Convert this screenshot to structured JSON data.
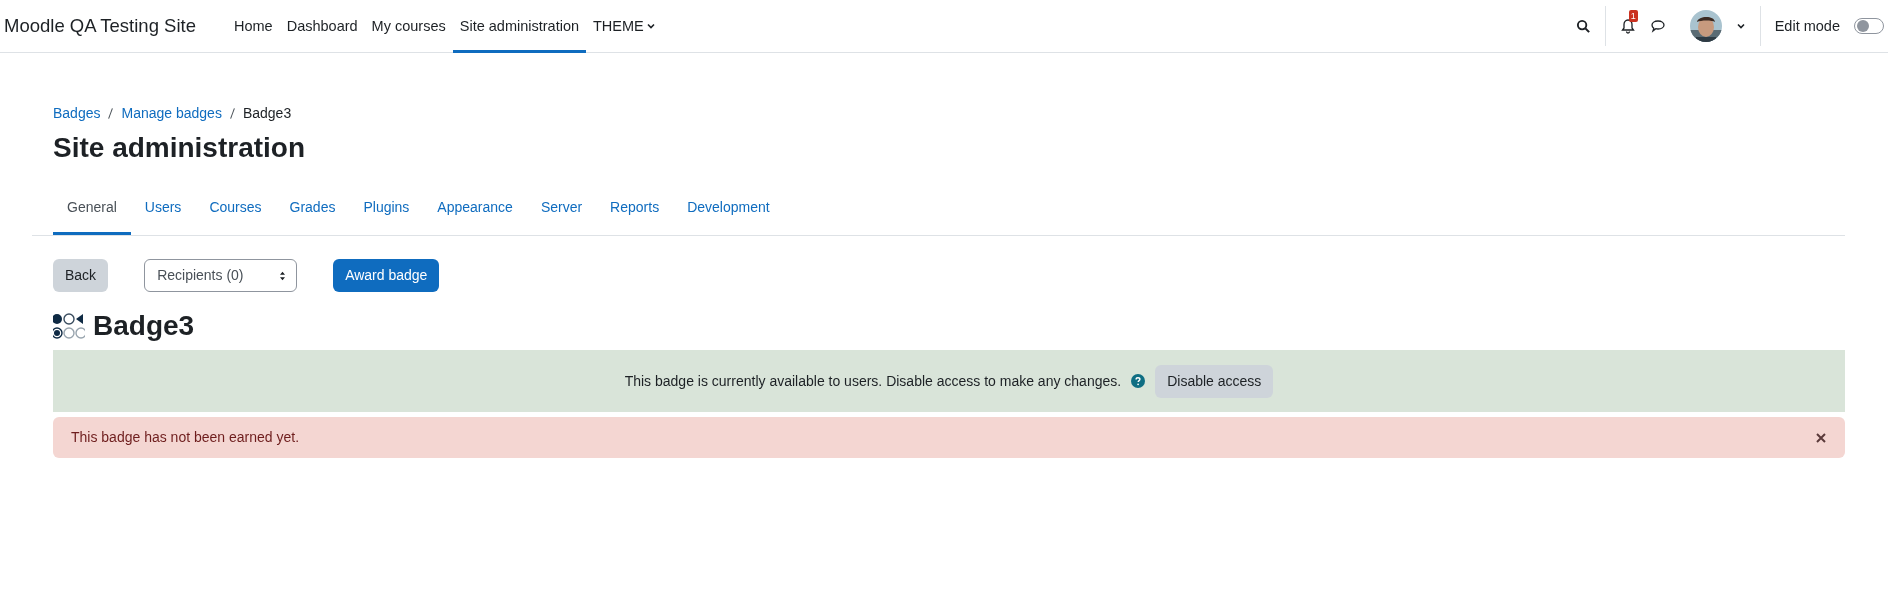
{
  "site_name": "Moodle QA Testing Site",
  "nav": [
    {
      "label": "Home",
      "selected": false,
      "dropdown": false
    },
    {
      "label": "Dashboard",
      "selected": false,
      "dropdown": false
    },
    {
      "label": "My courses",
      "selected": false,
      "dropdown": false
    },
    {
      "label": "Site administration",
      "selected": true,
      "dropdown": false
    },
    {
      "label": "THEME",
      "selected": false,
      "dropdown": true
    }
  ],
  "notifications": {
    "count": "1"
  },
  "edit_mode": {
    "label": "Edit mode",
    "on": false
  },
  "breadcrumb": [
    {
      "label": "Badges",
      "link": true
    },
    {
      "label": "Manage badges",
      "link": true
    },
    {
      "label": "Badge3",
      "link": false
    }
  ],
  "page_title": "Site administration",
  "tabs": [
    {
      "label": "General",
      "selected": true
    },
    {
      "label": "Users",
      "selected": false
    },
    {
      "label": "Courses",
      "selected": false
    },
    {
      "label": "Grades",
      "selected": false
    },
    {
      "label": "Plugins",
      "selected": false
    },
    {
      "label": "Appearance",
      "selected": false
    },
    {
      "label": "Server",
      "selected": false
    },
    {
      "label": "Reports",
      "selected": false
    },
    {
      "label": "Development",
      "selected": false
    }
  ],
  "actions": {
    "back": "Back",
    "recipients": "Recipients (0)",
    "award": "Award badge"
  },
  "badge_title": "Badge3",
  "status_notice": {
    "text": "This badge is currently available to users. Disable access to make any changes.",
    "button": "Disable access"
  },
  "alert": {
    "text": "This badge has not been earned yet."
  }
}
